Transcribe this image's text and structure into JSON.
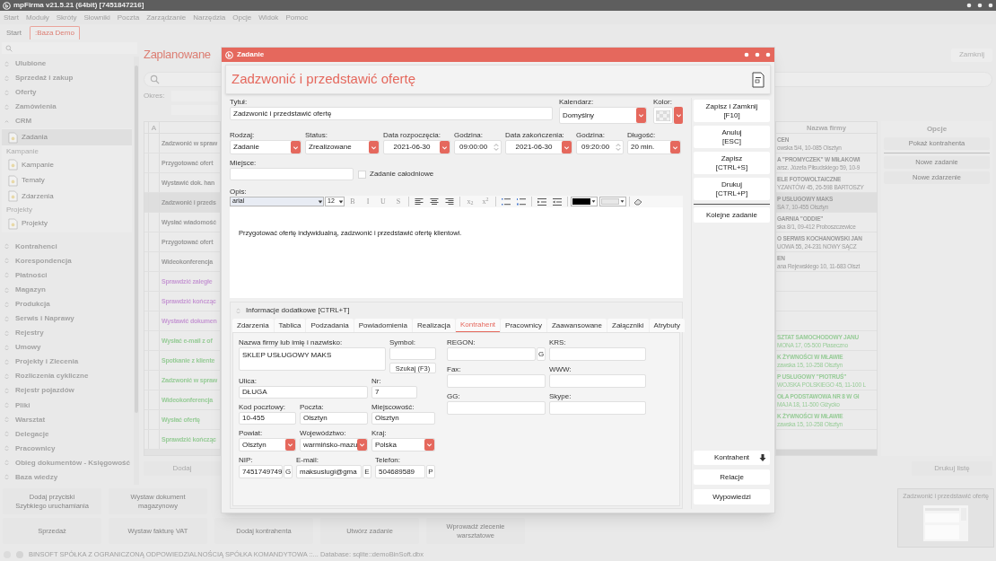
{
  "app": {
    "title": "mpFirma v21.5.21 (64bit) [7451847216]"
  },
  "menu": [
    "Start",
    "Moduły",
    "Skróty",
    "Słowniki",
    "Poczta",
    "Zarządzanie",
    "Narzędzia",
    "Opcje",
    "Widok",
    "Pomoc"
  ],
  "tabs": [
    {
      "label": "Start",
      "selected": false
    },
    {
      "label": ":Baza Demo",
      "selected": true
    }
  ],
  "sidebar": {
    "groups": [
      {
        "label": "Ulubione",
        "expanded": false
      },
      {
        "label": "Sprzedaż i zakup",
        "expanded": false
      },
      {
        "label": "Oferty",
        "expanded": false
      },
      {
        "label": "Zamówienia",
        "expanded": false
      },
      {
        "label": "CRM",
        "expanded": true,
        "children": [
          {
            "kind": "item",
            "label": "Zadania",
            "selected": true
          },
          {
            "kind": "section",
            "label": "Kampanie"
          },
          {
            "kind": "item",
            "label": "Kampanie",
            "selected": false
          },
          {
            "kind": "item",
            "label": "Tematy",
            "selected": false
          },
          {
            "kind": "item",
            "label": "Zdarzenia",
            "selected": false
          },
          {
            "kind": "section",
            "label": "Projekty"
          },
          {
            "kind": "item",
            "label": "Projekty",
            "selected": false
          }
        ]
      },
      {
        "label": "Kontrahenci",
        "expanded": false
      },
      {
        "label": "Korespondencja",
        "expanded": false
      },
      {
        "label": "Płatności",
        "expanded": false
      },
      {
        "label": "Magazyn",
        "expanded": false
      },
      {
        "label": "Produkcja",
        "expanded": false
      },
      {
        "label": "Serwis i Naprawy",
        "expanded": false
      },
      {
        "label": "Rejestry",
        "expanded": false
      },
      {
        "label": "Umowy",
        "expanded": false
      },
      {
        "label": "Projekty i Zlecenia",
        "expanded": false
      },
      {
        "label": "Rozliczenia cykliczne",
        "expanded": false
      },
      {
        "label": "Rejestr pojazdów",
        "expanded": false
      },
      {
        "label": "Pliki",
        "expanded": false
      },
      {
        "label": "Warsztat",
        "expanded": false
      },
      {
        "label": "Delegacje",
        "expanded": false
      },
      {
        "label": "Pracownicy",
        "expanded": false
      },
      {
        "label": "Obieg dokumentów - Księgowość",
        "expanded": false
      },
      {
        "label": "Baza wiedzy",
        "expanded": false
      }
    ]
  },
  "list_view": {
    "title": "Zaplanowane",
    "close_button": "Zamknij",
    "period_label": "Okres:",
    "column_a": "A",
    "tasks": [
      {
        "title": "Zadzwonić w spraw",
        "color": "#9a9a9a",
        "selected": false
      },
      {
        "title": "Przygotować ofert",
        "color": "#9a9a9a",
        "selected": false
      },
      {
        "title": "Wystawić dok. han",
        "color": "#9a9a9a",
        "selected": false
      },
      {
        "title": "Zadzwonić i przeds",
        "color": "#9a9a9a",
        "selected": true
      },
      {
        "title": "Wysłać wiadomość",
        "color": "#9a9a9a",
        "selected": false
      },
      {
        "title": "Przygotować ofert",
        "color": "#9a9a9a",
        "selected": false
      },
      {
        "title": "Wideokonferencja",
        "color": "#9a9a9a",
        "selected": false
      },
      {
        "title": "Sprawdzić zaległe",
        "color": "#c79ad4",
        "selected": false
      },
      {
        "title": "Sprawdzić kończąc",
        "color": "#c79ad4",
        "selected": false
      },
      {
        "title": "Wystawić dokumen",
        "color": "#c79ad4",
        "selected": false
      },
      {
        "title": "Wysłać e-mail z of",
        "color": "#98cc98",
        "selected": false
      },
      {
        "title": "Spotkanie z kliente",
        "color": "#98cc98",
        "selected": false
      },
      {
        "title": "Zadzwonić w spraw",
        "color": "#98cc98",
        "selected": false
      },
      {
        "title": "Wideokonferencja",
        "color": "#98cc98",
        "selected": false
      },
      {
        "title": "Wysłać ofertę",
        "color": "#98cc98",
        "selected": false
      },
      {
        "title": "Sprawdzić kończąc",
        "color": "#98cc98",
        "selected": false
      }
    ],
    "company_column": "Nazwa firmy",
    "companies": [
      {
        "kind": "company",
        "name": "CEN",
        "address": "owska 5/4, 10-085 Olsztyn",
        "color": "#9a9a9a",
        "selected": false
      },
      {
        "kind": "company",
        "name": "A \"PROMYCZEK\" W MIŁAKOWI",
        "address": "arsz. Józefa Piłsudskiego 59, 10-9",
        "color": "#9a9a9a",
        "selected": false
      },
      {
        "kind": "company",
        "name": "ELE FOTOWOLTAICZNE",
        "address": "YZANTÓW 45, 26-598 BARTOSZY",
        "color": "#9a9a9a",
        "selected": false
      },
      {
        "kind": "company",
        "name": "P USŁUGOWY MAKS",
        "address": "SA 7, 10-455 Olsztyn",
        "color": "#9a9a9a",
        "selected": true
      },
      {
        "kind": "company",
        "name": "GARNIA \"ODDIE\"",
        "address": "ska 8/1, 09-412 Proboszczewice",
        "color": "#9a9a9a",
        "selected": false
      },
      {
        "kind": "company",
        "name": "O SERWIS KOCHANOWSKI JAN",
        "address": "UOWA 55, 24-231 NOWY SĄCZ",
        "color": "#9a9a9a",
        "selected": false
      },
      {
        "kind": "company",
        "name": "EN",
        "address": "ana Rejewskiego 10, 11-683 Olszt",
        "color": "#9a9a9a",
        "selected": false
      },
      {
        "kind": "empty"
      },
      {
        "kind": "empty"
      },
      {
        "kind": "empty"
      },
      {
        "kind": "company",
        "name": "SZTAT SAMOCHODOWY JANU",
        "address": "MONA 17, 05-500 Piaseczno",
        "color": "#98cc98",
        "selected": false
      },
      {
        "kind": "company",
        "name": "K ŻYWNOŚCI W MŁAWIE",
        "address": "zawska 15, 10-258 Olsztyn",
        "color": "#98cc98",
        "selected": false
      },
      {
        "kind": "company",
        "name": "P USŁUGOWY \"PIOTRUŚ\"",
        "address": "WOJSKA POLSKIEGO 45, 11-100 L",
        "color": "#98cc98",
        "selected": false
      },
      {
        "kind": "company",
        "name": "OŁA PODSTAWOWA NR 8 W GI",
        "address": "MAJA 18, 11-500 Giżycko",
        "color": "#98cc98",
        "selected": false
      },
      {
        "kind": "company",
        "name": "K ŻYWNOŚCI W MŁAWIE",
        "address": "zawska 15, 10-258 Olsztyn",
        "color": "#98cc98",
        "selected": false
      },
      {
        "kind": "empty"
      }
    ],
    "options_title": "Opcje",
    "options": [
      {
        "label": "Pokaż kontrahenta",
        "kind": "button"
      },
      {
        "kind": "divider"
      },
      {
        "label": "Nowe zadanie",
        "kind": "button"
      },
      {
        "label": "Nowe zdarzenie",
        "kind": "button"
      }
    ],
    "add_button": "Dodaj",
    "print_button": "Drukuj listę"
  },
  "quick_buttons": [
    [
      "Dodaj przyciski\nSzybkiego uruchamiania",
      "Wystaw dokument\nmagazynowy"
    ],
    [
      "Sprzedaż",
      "Wystaw fakturę VAT",
      "Dodaj kontrahenta",
      "Utwórz zadanie",
      "Wprowadź zlecenie\nwarsztatowe"
    ]
  ],
  "status_bar": "BINSOFT SPÓŁKA Z OGRANICZONĄ ODPOWIEDZIALNOŚCIĄ SPÓŁKA KOMANDYTOWA ::... Database: sqlite::demoBinSoft.dbx",
  "thumbnail": {
    "title": "Zadzwonić i przedstawić ofertę"
  },
  "dialog": {
    "title": "Zadanie",
    "heading": "Zadzwonić i przedstawić ofertę",
    "title_field": {
      "label": "Tytuł:",
      "value": "Zadzwonić i przedstawić ofertę"
    },
    "calendar": {
      "label": "Kalendarz:",
      "value": "Domyślny"
    },
    "color": {
      "label": "Kolor:"
    },
    "fields": [
      {
        "label": "Rodzaj:",
        "value": "Zadanie",
        "kind": "select"
      },
      {
        "label": "Status:",
        "value": "Zrealizowane",
        "kind": "select"
      },
      {
        "label": "Data rozpoczęcia:",
        "value": "2021-06-30",
        "kind": "date"
      },
      {
        "label": "Godzina:",
        "value": "09:00:00",
        "kind": "time"
      },
      {
        "label": "Data zakończenia:",
        "value": "2021-06-30",
        "kind": "date"
      },
      {
        "label": "Godzina:",
        "value": "09:20:00",
        "kind": "time"
      },
      {
        "label": "Długość:",
        "value": "20 min.",
        "kind": "select"
      }
    ],
    "place": {
      "label": "Miejsce:"
    },
    "all_day": {
      "label": "Zadanie całodniowe",
      "checked": false
    },
    "description": {
      "label": "Opis:",
      "font": "arial",
      "size": "12",
      "format_buttons": [
        "B",
        "I",
        "U",
        "S"
      ],
      "script_buttons": [
        "x$_{2}$",
        "x$^{2}$"
      ],
      "text": "Przygotować ofertę indywidualną, zadzwonić i przedstawić ofertę klientowi."
    },
    "extra": {
      "label": "Informacje dodatkowe [CTRL+T]",
      "expanded": true,
      "tabs": [
        {
          "label": "Zdarzenia",
          "selected": false
        },
        {
          "label": "Tablica",
          "selected": false
        },
        {
          "label": "Podzadania",
          "selected": false
        },
        {
          "label": "Powiadomienia",
          "selected": false
        },
        {
          "label": "Realizacja",
          "selected": false
        },
        {
          "label": "Kontrahent",
          "selected": true
        },
        {
          "label": "Pracownicy",
          "selected": false
        },
        {
          "label": "Zaawansowane",
          "selected": false
        },
        {
          "label": "Załączniki",
          "selected": false
        },
        {
          "label": "Atrybuty",
          "selected": false
        }
      ],
      "contractor": {
        "name": {
          "label": "Nazwa firmy lub imię i nazwisko:",
          "value": "SKLEP USŁUGOWY MAKS"
        },
        "symbol": {
          "label": "Symbol:"
        },
        "search_button": "Szukaj (F3)",
        "street": {
          "label": "Ulica:",
          "value": "DŁUGA"
        },
        "number": {
          "label": "Nr:",
          "value": "7"
        },
        "postal_code": {
          "label": "Kod pocztowy:",
          "value": "10-455"
        },
        "post": {
          "label": "Poczta:",
          "value": "Olsztyn"
        },
        "city": {
          "label": "Miejscowość:",
          "value": "Olsztyn"
        },
        "county": {
          "label": "Powiat:",
          "value": "Olsztyn"
        },
        "province": {
          "label": "Województwo:",
          "value": "warmińsko-mazu"
        },
        "country": {
          "label": "Kraj:",
          "value": "Polska"
        },
        "nip": {
          "label": "NIP:",
          "value": "7451749749",
          "button": "G"
        },
        "email": {
          "label": "E-mail:",
          "value": "maksuslugi@gma",
          "button": "E"
        },
        "phone": {
          "label": "Telefon:",
          "value": "504689589",
          "button": "P"
        },
        "regon": {
          "label": "REGON:",
          "button": "G"
        },
        "krs": {
          "label": "KRS:"
        },
        "fax": {
          "label": "Fax:"
        },
        "www": {
          "label": "WWW:"
        },
        "gg": {
          "label": "GG:"
        },
        "skype": {
          "label": "Skype:"
        }
      }
    },
    "actions": [
      {
        "label": "Zapisz i Zamknij",
        "shortcut": "[F10]"
      },
      {
        "label": "Anuluj",
        "shortcut": "[ESC]"
      },
      {
        "label": "Zapisz",
        "shortcut": "[CTRL+S]"
      },
      {
        "label": "Drukuj",
        "shortcut": "[CTRL+P]"
      }
    ],
    "next_button": "Kolejne zadanie",
    "bottom_actions": [
      {
        "label": "Kontrahent",
        "kind": "menu"
      },
      {
        "label": "Relacje",
        "kind": "button"
      },
      {
        "label": "Wypowiedzi",
        "kind": "button"
      }
    ]
  }
}
